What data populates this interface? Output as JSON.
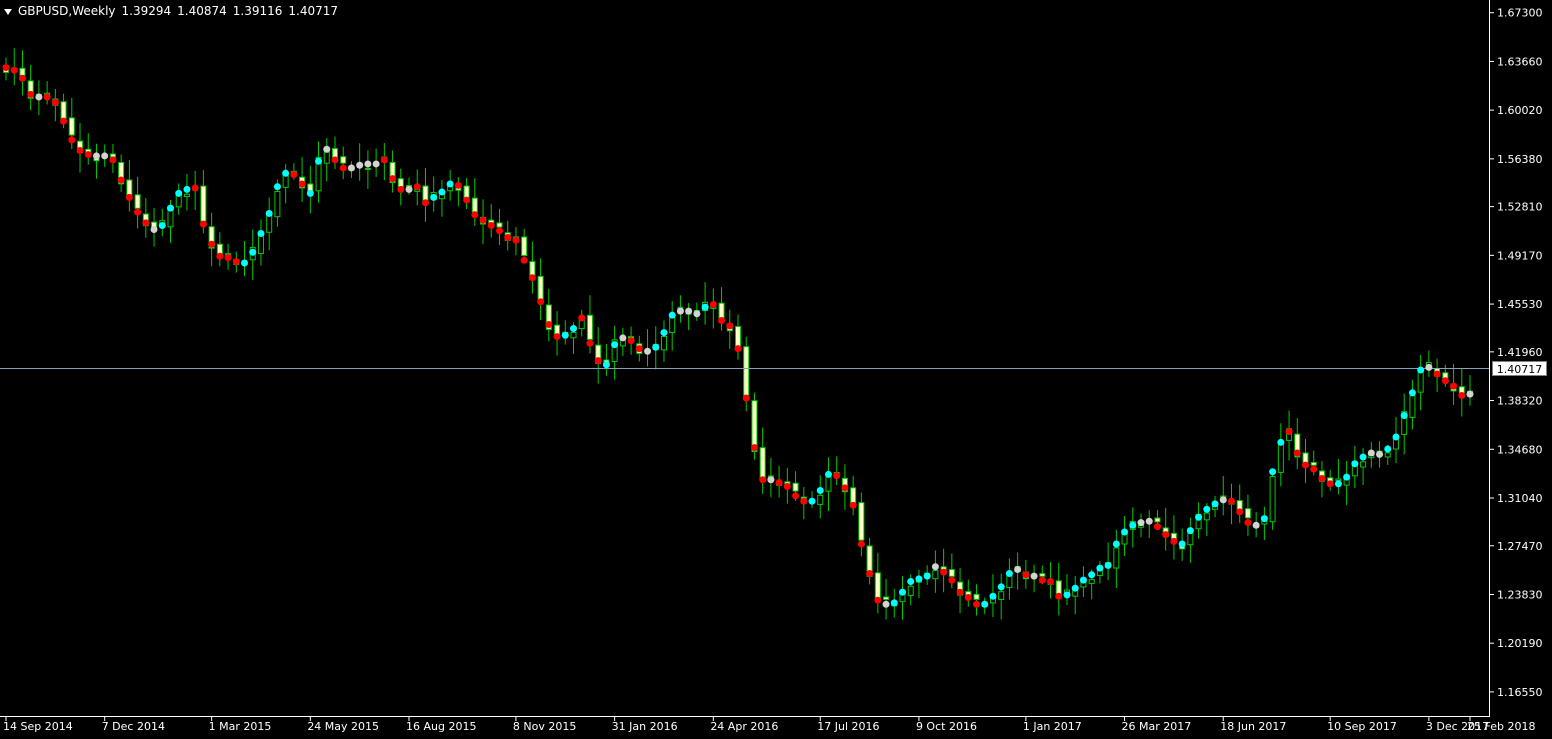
{
  "header": {
    "symbol": "GBPUSD,Weekly",
    "open": "1.39294",
    "high": "1.40874",
    "low": "1.39116",
    "close": "1.40717"
  },
  "current_price_label": "1.40717",
  "colors": {
    "background": "#000000",
    "axis": "#ffffff",
    "bull_body": "#000000",
    "bear_body": "#ffffc8",
    "wick": "#00cc00",
    "dot_red": "#ff0000",
    "dot_cyan": "#00ffff",
    "dot_gray": "#d3d3d3",
    "price_line": "#8aa0b4"
  },
  "chart_data": {
    "type": "line",
    "title": "GBPUSD,Weekly",
    "ylim": [
      1.1475,
      1.6825
    ],
    "y_ticks": [
      "1.67300",
      "1.63660",
      "1.60020",
      "1.56380",
      "1.52810",
      "1.49170",
      "1.45530",
      "1.41960",
      "1.38320",
      "1.34680",
      "1.31040",
      "1.27470",
      "1.23830",
      "1.20190",
      "1.16550"
    ],
    "x_ticks": [
      "14 Sep 2014",
      "7 Dec 2014",
      "1 Mar 2015",
      "24 May 2015",
      "16 Aug 2015",
      "8 Nov 2015",
      "31 Jan 2016",
      "24 Apr 2016",
      "17 Jul 2016",
      "9 Oct 2016",
      "1 Jan 2017",
      "26 Mar 2017",
      "18 Jun 2017",
      "10 Sep 2017",
      "3 Dec 2017",
      "25 Feb 2018"
    ],
    "grid": false,
    "current_price": 1.40717,
    "series": [
      {
        "values": [
          1.632,
          1.63,
          1.624,
          1.612,
          1.61,
          1.61,
          1.606,
          1.592,
          1.578,
          1.57,
          1.567,
          1.566,
          1.566,
          1.563,
          1.548,
          1.535,
          1.524,
          1.516,
          1.511,
          1.514,
          1.527,
          1.538,
          1.541,
          1.542,
          1.515,
          1.5,
          1.491,
          1.49,
          1.487,
          1.486,
          1.494,
          1.508,
          1.523,
          1.543,
          1.553,
          1.552,
          1.545,
          1.538,
          1.562,
          1.571,
          1.563,
          1.557,
          1.557,
          1.559,
          1.56,
          1.56,
          1.563,
          1.549,
          1.541,
          1.541,
          1.543,
          1.531,
          1.535,
          1.539,
          1.545,
          1.544,
          1.533,
          1.522,
          1.518,
          1.514,
          1.51,
          1.505,
          1.503,
          1.488,
          1.475,
          1.457,
          1.44,
          1.431,
          1.432,
          1.437,
          1.445,
          1.426,
          1.413,
          1.41,
          1.425,
          1.43,
          1.428,
          1.422,
          1.42,
          1.423,
          1.434,
          1.447,
          1.45,
          1.45,
          1.448,
          1.453,
          1.455,
          1.443,
          1.439,
          1.422,
          1.385,
          1.348,
          1.324,
          1.324,
          1.322,
          1.319,
          1.312,
          1.308,
          1.308,
          1.316,
          1.328,
          1.327,
          1.318,
          1.305,
          1.276,
          1.254,
          1.234,
          1.231,
          1.232,
          1.24,
          1.248,
          1.25,
          1.252,
          1.259,
          1.255,
          1.249,
          1.24,
          1.236,
          1.231,
          1.231,
          1.237,
          1.244,
          1.254,
          1.257,
          1.253,
          1.252,
          1.249,
          1.248,
          1.237,
          1.238,
          1.243,
          1.249,
          1.253,
          1.258,
          1.26,
          1.276,
          1.285,
          1.29,
          1.292,
          1.293,
          1.289,
          1.283,
          1.278,
          1.276,
          1.286,
          1.296,
          1.302,
          1.306,
          1.309,
          1.308,
          1.3,
          1.292,
          1.29,
          1.295,
          1.33,
          1.352,
          1.36,
          1.344,
          1.335,
          1.332,
          1.325,
          1.321,
          1.321,
          1.326,
          1.336,
          1.341,
          1.344,
          1.343,
          1.347,
          1.356,
          1.372,
          1.389,
          1.406,
          1.408,
          1.403,
          1.398,
          1.394,
          1.387,
          1.388
        ]
      }
    ]
  }
}
